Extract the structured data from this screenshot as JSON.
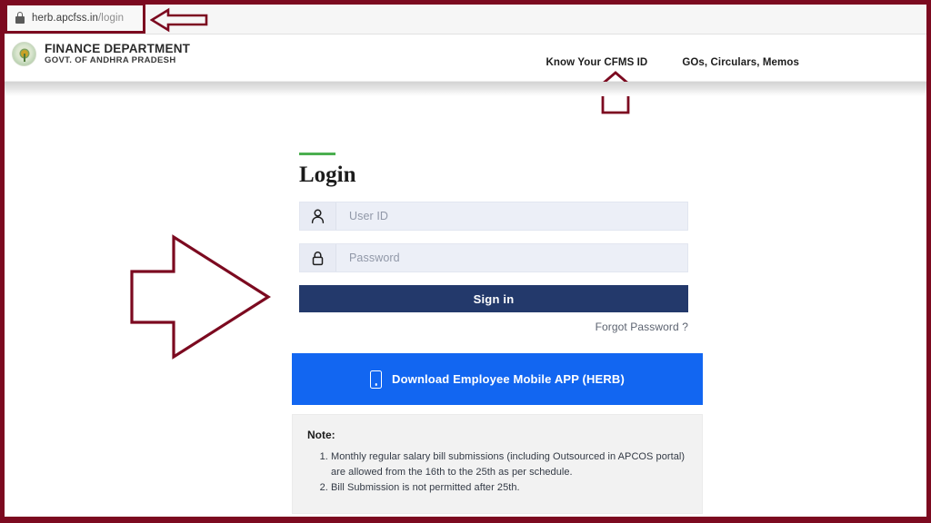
{
  "browser": {
    "url_host": "herb.apcfss.in",
    "url_path": "/login",
    "lock_icon": "lock-icon"
  },
  "header": {
    "logo_icon": "andhra-pradesh-emblem-icon",
    "org_line1": "FINANCE DEPARTMENT",
    "org_line2": "GOVT. OF ANDHRA PRADESH",
    "nav": [
      {
        "label": "Know Your CFMS ID"
      },
      {
        "label": "GOs, Circulars, Memos"
      }
    ]
  },
  "login": {
    "title": "Login",
    "user_id": {
      "icon": "user-icon",
      "placeholder": "User ID",
      "value": ""
    },
    "password": {
      "icon": "lock-icon",
      "placeholder": "Password",
      "value": ""
    },
    "signin_label": "Sign in",
    "forgot_label": "Forgot Password ?"
  },
  "download": {
    "icon": "mobile-phone-icon",
    "label": "Download Employee Mobile APP (HERB)"
  },
  "note": {
    "title": "Note:",
    "items": [
      "Monthly regular salary bill submissions (including Outsourced in APCOS portal) are allowed from the 16th to the 25th as per schedule.",
      "Bill Submission is not permitted after 25th."
    ]
  },
  "annotations": {
    "url_arrow": "left-arrow-annotation",
    "nav_arrow": "up-arrow-annotation",
    "login_arrow": "right-arrow-annotation"
  },
  "colors": {
    "annotation": "#7c0a20",
    "accent_green": "#4caf50",
    "signin_navy": "#23396b",
    "download_blue": "#1266f1",
    "note_bg": "#f2f2f2"
  }
}
